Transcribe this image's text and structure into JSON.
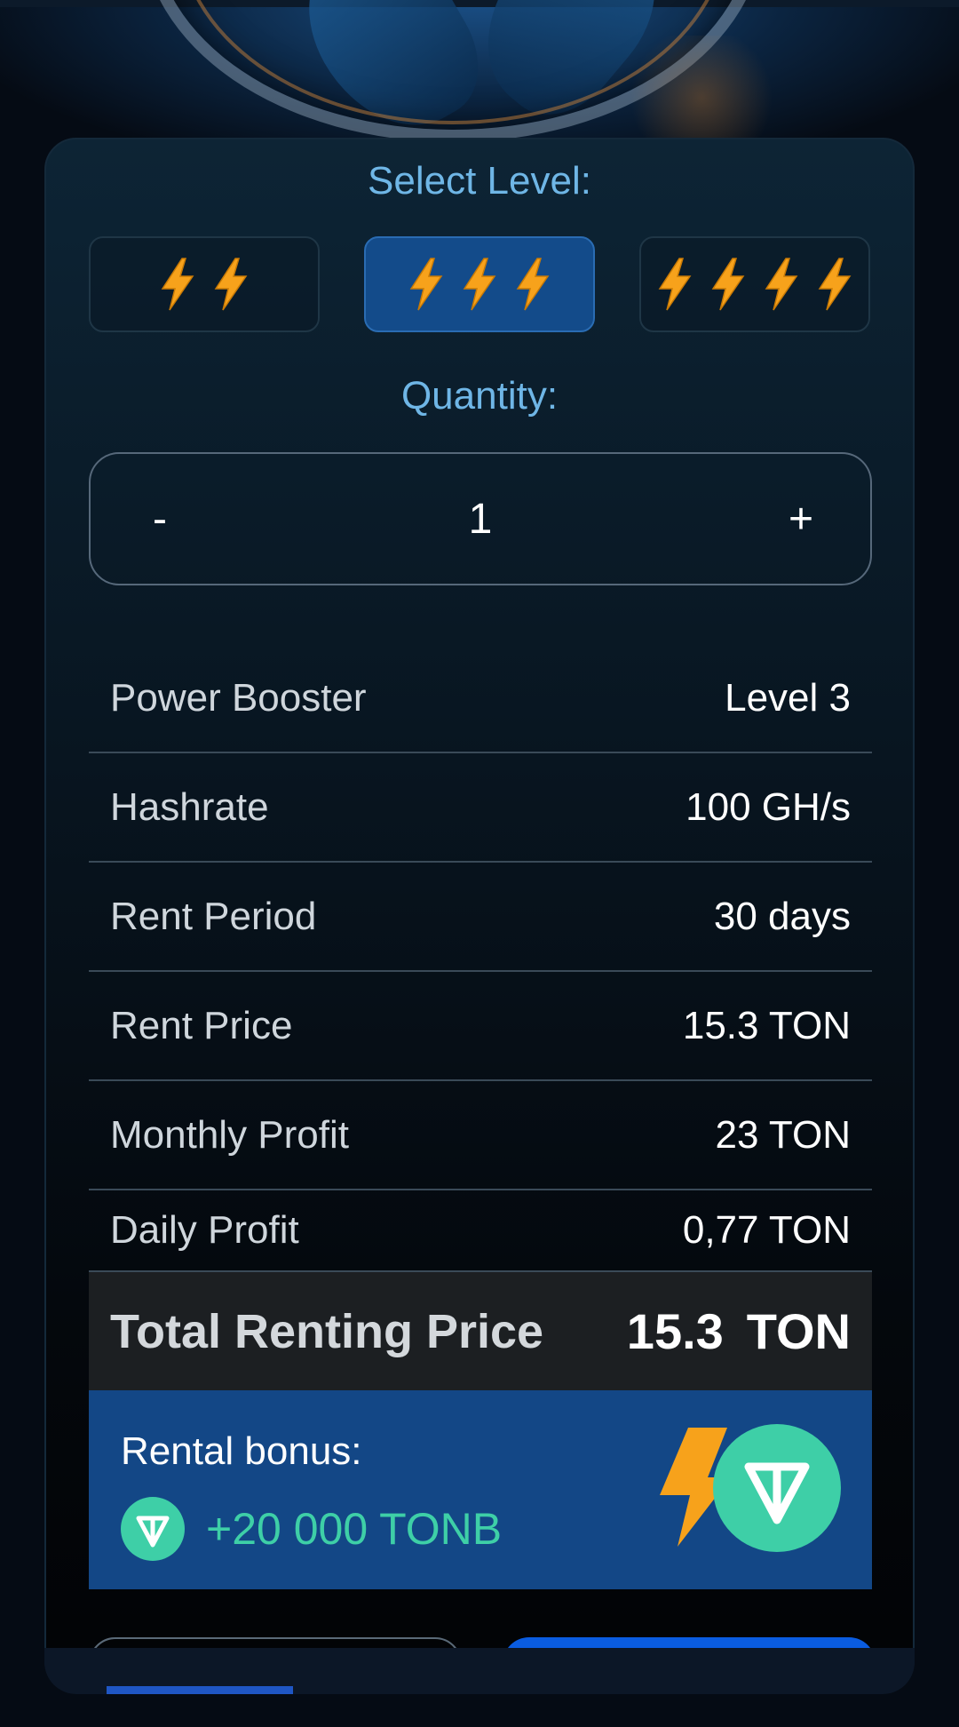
{
  "select_level": {
    "title": "Select Level:",
    "options": [
      {
        "bolts": 2,
        "selected": false
      },
      {
        "bolts": 3,
        "selected": true
      },
      {
        "bolts": 4,
        "selected": false
      }
    ]
  },
  "quantity": {
    "title": "Quantity:",
    "minus_label": "-",
    "value": "1",
    "plus_label": "+"
  },
  "details": [
    {
      "label": "Power Booster",
      "value": "Level 3"
    },
    {
      "label": "Hashrate",
      "value": "100 GH/s"
    },
    {
      "label": "Rent Period",
      "value": "30 days"
    },
    {
      "label": "Rent Price",
      "value": "15.3 TON"
    },
    {
      "label": "Monthly Profit",
      "value": "23 TON"
    },
    {
      "label": "Daily Profit",
      "value": "0,77 TON"
    }
  ],
  "total": {
    "label": "Total Renting Price",
    "amount": "15.3",
    "currency": "TON"
  },
  "bonus": {
    "title": "Rental bonus:",
    "amount": "+20 000 TONB"
  },
  "colors": {
    "accent_blue": "#134b8a",
    "ton_green": "#3ecfa7",
    "bolt_orange": "#f7a21b"
  }
}
